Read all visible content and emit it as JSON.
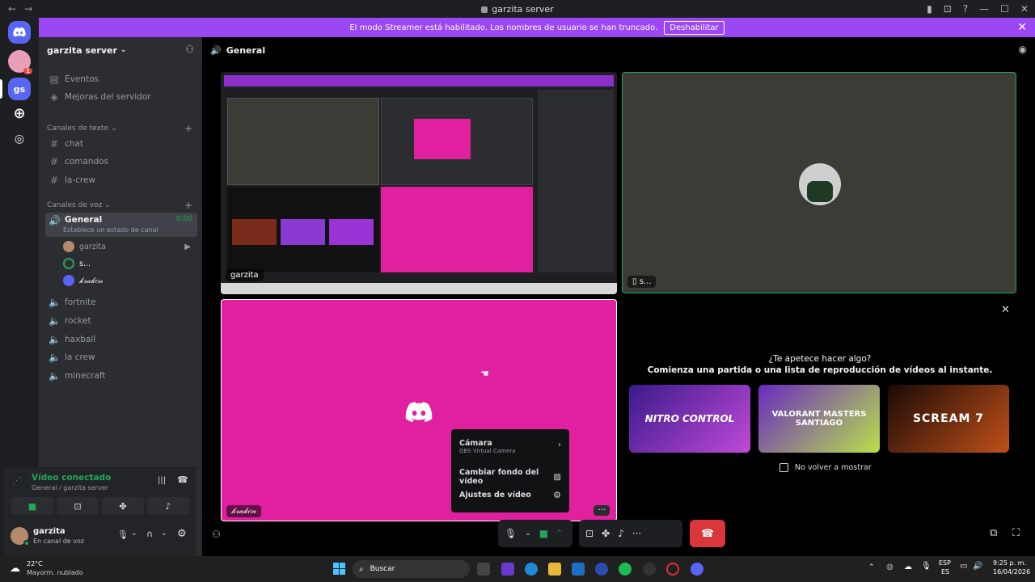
{
  "window": {
    "title": "garzita server"
  },
  "banner": {
    "text": "El modo Streamer está habilitado. Los nombres de usuario se han truncado.",
    "button": "Deshabilitar"
  },
  "guilds": {
    "badge": "1",
    "server_initials": "gs"
  },
  "server": {
    "name": "garzita server"
  },
  "sidebar": {
    "top_items": [
      "Eventos",
      "Mejoras del servidor"
    ],
    "text_category": "Canales de texto",
    "text_channels": [
      "chat",
      "comandos",
      "la-crew"
    ],
    "voice_category": "Canales de voz",
    "general": {
      "name": "General",
      "timer": "0:00",
      "status": "Establece un estado de canal"
    },
    "voice_participants": [
      "garzita",
      "s...",
      "𝓀𝓇𝒶𝓀𝑒𝓃"
    ],
    "voice_channels": [
      "fortnite",
      "rocket",
      "haxball",
      "la crew",
      "minecraft"
    ]
  },
  "voice_connection": {
    "status": "Vídeo conectado",
    "location": "General / garzita server"
  },
  "user": {
    "name": "garzita",
    "status": "En canal de voz"
  },
  "channel_header": {
    "name": "General"
  },
  "tiles": {
    "screen_share_user": "garzita",
    "top_right_user": "s...",
    "camera_user": "𝓀𝓇𝒶𝓀𝑒𝓃"
  },
  "context_menu": {
    "camera_label": "Cámara",
    "camera_value": "OBS Virtual Camera",
    "bg_label": "Cambiar fondo del vídeo",
    "settings_label": "Ajustes de vídeo"
  },
  "activity": {
    "title": "¿Te apetece hacer algo?",
    "subtitle": "Comienza una partida o una lista de reproducción de vídeos al instante.",
    "cards": [
      "NITRO CONTROL",
      "VALORANT MASTERS SANTIAGO",
      "SCREAM 7"
    ],
    "checkbox": "No volver a mostrar"
  },
  "taskbar": {
    "weather_temp": "22°C",
    "weather_desc": "Mayorm. nublado",
    "search": "Buscar",
    "lang": "ESP",
    "lang2": "ES",
    "time": "9:25 p. m.",
    "date": "16/04/2026"
  },
  "colors": {
    "accent": "#5865f2",
    "banner": "#9b47f3",
    "green": "#23a55a",
    "danger": "#da373c",
    "pink": "#e0209e"
  }
}
